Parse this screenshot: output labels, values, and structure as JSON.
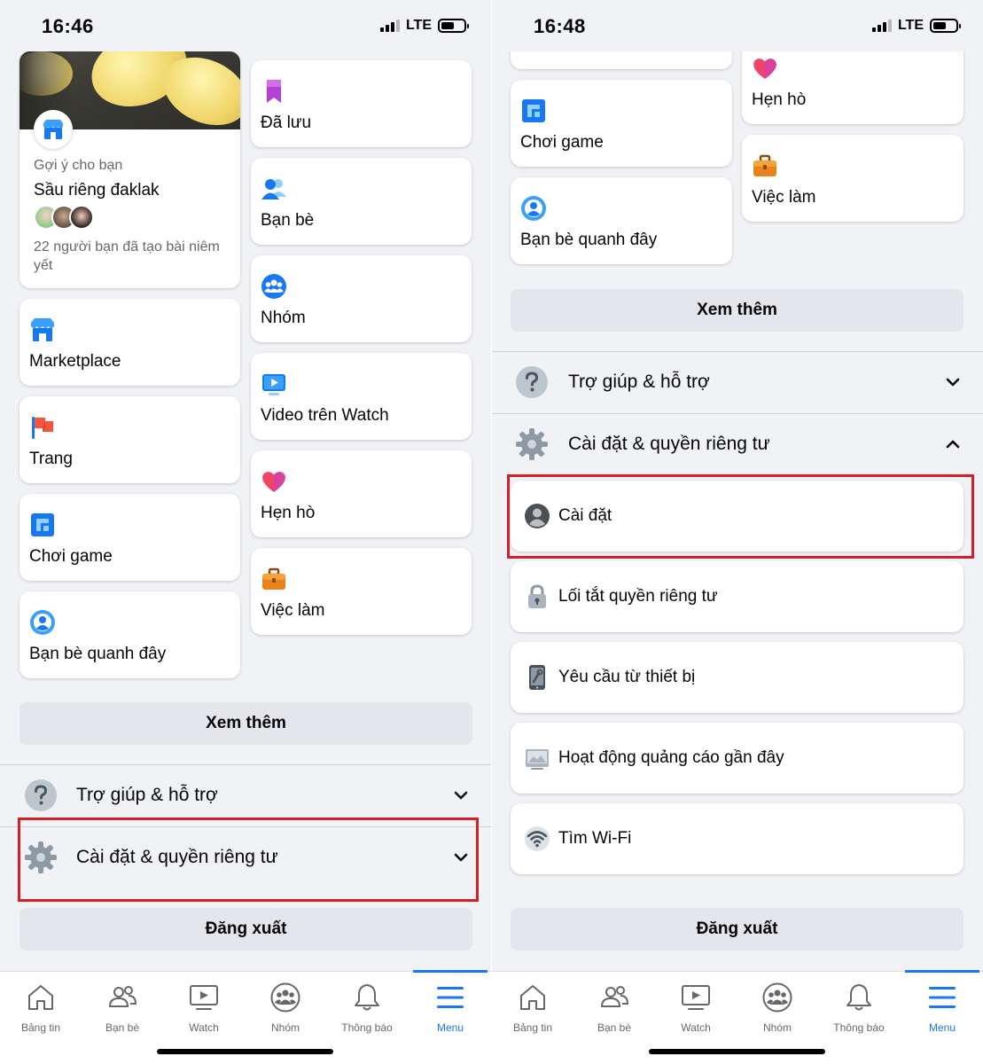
{
  "left": {
    "status": {
      "time": "16:46",
      "network": "LTE"
    },
    "suggestion": {
      "subtitle": "Gợi ý cho bạn",
      "title": "Sầu riêng đaklak",
      "description": "22 người bạn đã tạo bài niêm yết"
    },
    "shortcuts_col1": [
      {
        "label": "Marketplace",
        "icon": "marketplace-icon"
      },
      {
        "label": "Trang",
        "icon": "flag-icon"
      },
      {
        "label": "Chơi game",
        "icon": "gaming-icon"
      },
      {
        "label": "Bạn bè quanh đây",
        "icon": "nearby-friends-icon"
      }
    ],
    "shortcuts_col2": [
      {
        "label": "Đã lưu",
        "icon": "bookmark-icon"
      },
      {
        "label": "Bạn bè",
        "icon": "friends-icon"
      },
      {
        "label": "Nhóm",
        "icon": "groups-icon"
      },
      {
        "label": "Video trên Watch",
        "icon": "watch-video-icon"
      },
      {
        "label": "Hẹn hò",
        "icon": "heart-icon"
      },
      {
        "label": "Việc làm",
        "icon": "briefcase-icon"
      }
    ],
    "see_more": "Xem thêm",
    "help": "Trợ giúp & hỗ trợ",
    "settings_privacy": "Cài đặt & quyền riêng tư",
    "logout": "Đăng xuất"
  },
  "right": {
    "status": {
      "time": "16:48",
      "network": "LTE"
    },
    "shortcuts_col1": [
      {
        "label": "Chơi game",
        "icon": "gaming-icon"
      },
      {
        "label": "Bạn bè quanh đây",
        "icon": "nearby-friends-icon"
      }
    ],
    "shortcuts_col2": [
      {
        "label": "Hẹn hò",
        "icon": "heart-icon"
      },
      {
        "label": "Việc làm",
        "icon": "briefcase-icon"
      }
    ],
    "see_more": "Xem thêm",
    "help": "Trợ giúp & hỗ trợ",
    "settings_privacy": "Cài đặt & quyền riêng tư",
    "settings_items": [
      {
        "label": "Cài đặt",
        "icon": "profile-settings-icon"
      },
      {
        "label": "Lối tắt quyền riêng tư",
        "icon": "lock-icon"
      },
      {
        "label": "Yêu cầu từ thiết bị",
        "icon": "device-icon"
      },
      {
        "label": "Hoạt động quảng cáo gần đây",
        "icon": "ad-activity-icon"
      },
      {
        "label": "Tìm Wi-Fi",
        "icon": "wifi-icon"
      }
    ],
    "logout": "Đăng xuất"
  },
  "tabs": [
    {
      "label": "Bảng tin",
      "icon": "home-icon"
    },
    {
      "label": "Bạn bè",
      "icon": "friends-tab-icon"
    },
    {
      "label": "Watch",
      "icon": "watch-tab-icon"
    },
    {
      "label": "Nhóm",
      "icon": "groups-tab-icon"
    },
    {
      "label": "Thông báo",
      "icon": "bell-icon"
    },
    {
      "label": "Menu",
      "icon": "menu-icon"
    }
  ],
  "colors": {
    "accent": "#1877f2",
    "highlight": "#d4202a",
    "background": "#f0f2f5"
  }
}
